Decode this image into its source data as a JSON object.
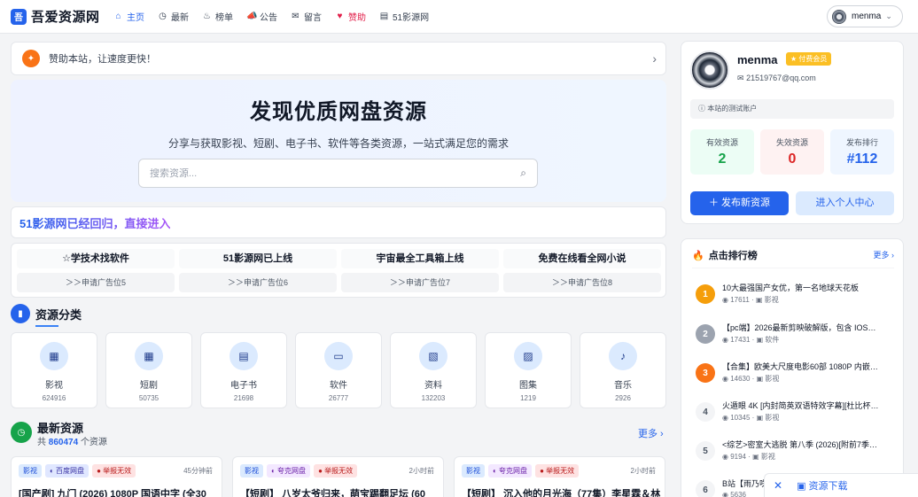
{
  "header": {
    "logo_icon": "吾",
    "site_name": "吾爱资源网",
    "nav": [
      {
        "icon": "⌂",
        "label": "主页",
        "active": true
      },
      {
        "icon": "◷",
        "label": "最新"
      },
      {
        "icon": "♨",
        "label": "榜单"
      },
      {
        "icon": "📣",
        "label": "公告"
      },
      {
        "icon": "✉",
        "label": "留言"
      },
      {
        "icon": "♥",
        "label": "赞助",
        "red": true
      },
      {
        "icon": "▤",
        "label": "51影源网"
      }
    ],
    "user": {
      "name": "menma",
      "chevron": "⌄"
    }
  },
  "notice": {
    "icon": "✦",
    "text": "赞助本站，让速度更快！",
    "arrow": "›"
  },
  "hero": {
    "title": "发现优质网盘资源",
    "subtitle": "分享与获取影视、短剧、电子书、软件等各类资源，一站式满足您的需求",
    "search_placeholder": "搜索资源...",
    "search_icon": "⌕"
  },
  "banner": {
    "text": "51影源网已经回归，直接进入"
  },
  "ads": [
    {
      "title": "☆学技术找软件",
      "slot": "＞＞申请广告位5"
    },
    {
      "title": "51影源网已上线",
      "slot": "＞＞申请广告位6"
    },
    {
      "title": "宇宙最全工具箱上线",
      "slot": "＞＞申请广告位7"
    },
    {
      "title": "免费在线看全网小说",
      "slot": "＞＞申请广告位8"
    }
  ],
  "categories_section": {
    "icon": "▮",
    "title": "资源分类",
    "accent": "#2563eb"
  },
  "categories": [
    {
      "icon": "▦",
      "name": "影视",
      "count": "624916"
    },
    {
      "icon": "▦",
      "name": "短剧",
      "count": "50735"
    },
    {
      "icon": "▤",
      "name": "电子书",
      "count": "21698"
    },
    {
      "icon": "▭",
      "name": "软件",
      "count": "26777"
    },
    {
      "icon": "▧",
      "name": "资料",
      "count": "132203"
    },
    {
      "icon": "▨",
      "name": "图集",
      "count": "1219"
    },
    {
      "icon": "♪",
      "name": "音乐",
      "count": "2926"
    }
  ],
  "latest": {
    "icon": "◷",
    "title": "最新资源",
    "prefix": "共",
    "total": "860474",
    "suffix": "个资源",
    "more": "更多 ›",
    "accent": "#16a34a"
  },
  "cards": [
    {
      "tags": [
        "影视",
        "◐ 百度网盘",
        "● 举报无效"
      ],
      "time": "45分钟前",
      "title": "[国产剧] 九门 (2026) 1080P 国语中字 (全30"
    },
    {
      "tags": [
        "影视",
        "◐ 夸克网盘",
        "● 举报无效"
      ],
      "time": "2小时前",
      "title": "【短剧】 八岁太爷归来，萌宝踢翻足坛 (60"
    },
    {
      "tags": [
        "影视",
        "◐ 夸克网盘",
        "● 举报无效"
      ],
      "time": "2小时前",
      "title": "【短剧】 沉入他的月光海（77集）李星霖＆林"
    }
  ],
  "profile": {
    "name": "menma",
    "vip": "★ 付费会员",
    "email_icon": "✉",
    "email": "21519767@qq.com",
    "note_icon": "ⓘ",
    "note": "本站的测试账户",
    "stats": [
      {
        "label": "有效资源",
        "value": "2",
        "color": "#16a34a",
        "bg": "#ecfdf5"
      },
      {
        "label": "失效资源",
        "value": "0",
        "color": "#dc2626",
        "bg": "#fef2f2"
      },
      {
        "label": "发布排行",
        "value": "#112",
        "color": "#2563eb",
        "bg": "#eff6ff"
      }
    ],
    "publish_button": "＋ 发布新资源",
    "center_button": "进入个人中心"
  },
  "ranking": {
    "icon": "🔥",
    "title": "点击排行榜",
    "more": "更多 ›",
    "items": [
      {
        "rank": "1",
        "title": "10大最强国产女优，第一名地球天花板",
        "views": "◉ 17611",
        "cat": "▣ 影视",
        "bg": "#f59e0b",
        "fg": "#fff"
      },
      {
        "rank": "2",
        "title": "【pc端】2026最新剪映破解版，包含 IOS…",
        "views": "◉ 17431",
        "cat": "▣ 软件",
        "bg": "#9ca3af",
        "fg": "#fff"
      },
      {
        "rank": "3",
        "title": "【合集】欧美大尺度电影60部 1080P 内嵌…",
        "views": "◉ 14630",
        "cat": "▣ 影视",
        "bg": "#f97316",
        "fg": "#fff"
      },
      {
        "rank": "4",
        "title": "火遁眼 4K [内封简英双语特效字幕][杜比杯…",
        "views": "◉ 10345",
        "cat": "▣ 影视",
        "bg": "#f3f4f6",
        "fg": "#4b5563"
      },
      {
        "rank": "5",
        "title": "<综艺>密室大逃脱 第八季 (2026)[附前7季…",
        "views": "◉ 9194",
        "cat": "▣ 影视",
        "bg": "#f3f4f6",
        "fg": "#4b5563"
      },
      {
        "rank": "6",
        "title": "B站【雨乃咲…",
        "views": "◉ 5636",
        "cat": "",
        "bg": "#f3f4f6",
        "fg": "#4b5563"
      }
    ]
  },
  "float": {
    "close": "✕",
    "label": "▣ 资源下载"
  }
}
